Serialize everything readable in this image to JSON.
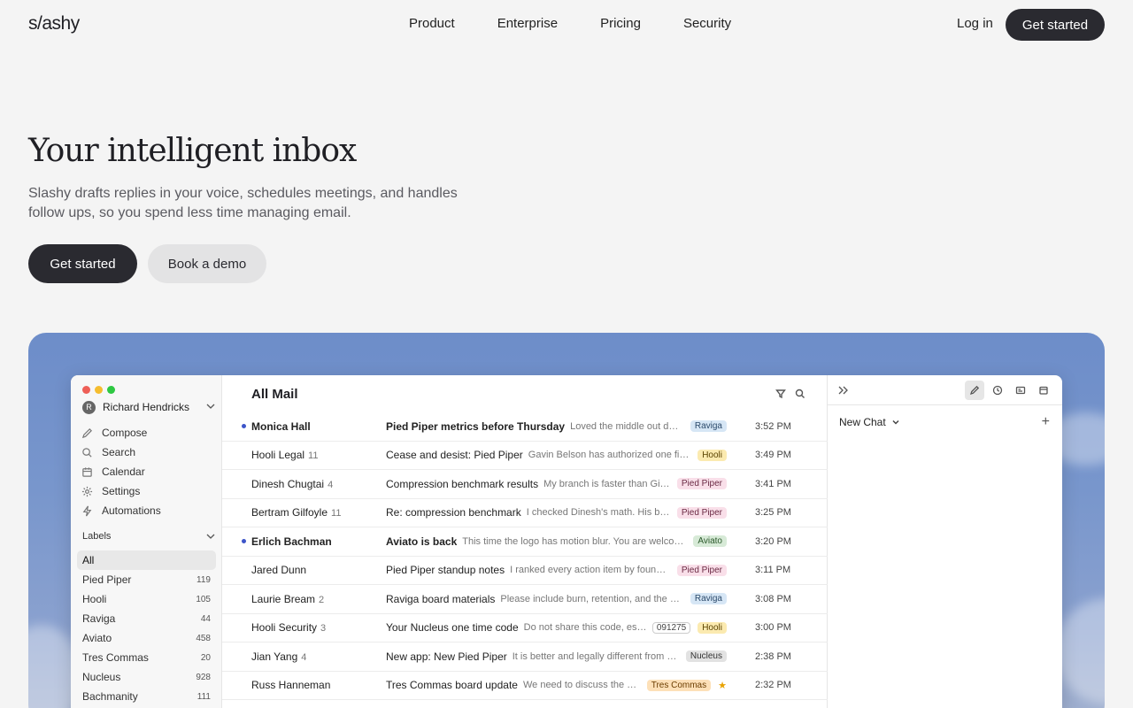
{
  "nav": {
    "logo": "s/ashy",
    "links": [
      "Product",
      "Enterprise",
      "Pricing",
      "Security"
    ],
    "login": "Log in",
    "cta": "Get started"
  },
  "hero": {
    "title": "Your intelligent inbox",
    "subtitle": "Slashy drafts replies in your voice, schedules meetings, and handles follow ups, so you spend less time managing email.",
    "primary_button": "Get started",
    "secondary_button": "Book a demo"
  },
  "app": {
    "account_initial": "R",
    "account_name": "Richard Hendricks",
    "menu": [
      {
        "label": "Compose",
        "icon": "pencil-icon"
      },
      {
        "label": "Search",
        "icon": "search-icon"
      },
      {
        "label": "Calendar",
        "icon": "calendar-icon"
      },
      {
        "label": "Settings",
        "icon": "gear-icon"
      },
      {
        "label": "Automations",
        "icon": "bolt-icon"
      }
    ],
    "labels_heading": "Labels",
    "labels": [
      {
        "name": "All",
        "count": "",
        "active": true
      },
      {
        "name": "Pied Piper",
        "count": "119"
      },
      {
        "name": "Hooli",
        "count": "105"
      },
      {
        "name": "Raviga",
        "count": "44"
      },
      {
        "name": "Aviato",
        "count": "458"
      },
      {
        "name": "Tres Commas",
        "count": "20"
      },
      {
        "name": "Nucleus",
        "count": "928"
      },
      {
        "name": "Bachmanity",
        "count": "111"
      }
    ],
    "list_title": "All Mail",
    "emails": [
      {
        "sender": "Monica Hall",
        "count": "",
        "unread": true,
        "subject": "Pied Piper metrics before Thursday",
        "preview": "Loved the middle out demo...",
        "tag": "Raviga",
        "time": "3:52 PM"
      },
      {
        "sender": "Hooli Legal",
        "count": "11",
        "unread": false,
        "subject": "Cease and desist: Pied Piper",
        "preview": "Gavin Belson has authorized one final,...",
        "tag": "Hooli",
        "time": "3:49 PM"
      },
      {
        "sender": "Dinesh Chugtai",
        "count": "4",
        "unread": false,
        "subject": "Compression benchmark results",
        "preview": "My branch is faster than Gilf...",
        "tag": "Pied Piper",
        "time": "3:41 PM"
      },
      {
        "sender": "Bertram Gilfoyle",
        "count": "11",
        "unread": false,
        "subject": "Re: compression benchmark",
        "preview": "I checked Dinesh's math. His ben...",
        "tag": "Pied Piper",
        "time": "3:25 PM"
      },
      {
        "sender": "Erlich Bachman",
        "count": "",
        "unread": true,
        "subject": "Aviato is back",
        "preview": "This time the logo has motion blur. You are welcome.",
        "tag": "Aviato",
        "time": "3:20 PM"
      },
      {
        "sender": "Jared Dunn",
        "count": "",
        "unread": false,
        "subject": "Pied Piper standup notes",
        "preview": "I ranked every action item by founde...",
        "tag": "Pied Piper",
        "time": "3:11 PM"
      },
      {
        "sender": "Laurie Bream",
        "count": "2",
        "unread": false,
        "subject": "Raviga board materials",
        "preview": "Please include burn, retention, and the up...",
        "tag": "Raviga",
        "time": "3:08 PM"
      },
      {
        "sender": "Hooli Security",
        "count": "3",
        "unread": false,
        "subject": "Your Nucleus one time code",
        "preview": "Do not share this code, esp...",
        "code": "091275",
        "tag": "Hooli",
        "time": "3:00 PM"
      },
      {
        "sender": "Jian Yang",
        "count": "4",
        "unread": false,
        "subject": "New app: New Pied Piper",
        "preview": "It is better and legally different from y...",
        "tag": "Nucleus",
        "time": "2:38 PM"
      },
      {
        "sender": "Russ Hanneman",
        "count": "",
        "unread": false,
        "subject": "Tres Commas board update",
        "preview": "We need to discuss the doors ...",
        "tag": "Tres Commas",
        "starred": true,
        "time": "2:32 PM"
      }
    ],
    "tag_colors": {
      "Raviga": {
        "bg": "#d6e6f5",
        "fg": "#2c4a6b"
      },
      "Hooli": {
        "bg": "#fbeab0",
        "fg": "#5a4300"
      },
      "Pied Piper": {
        "bg": "#f9dfe9",
        "fg": "#6b2a44"
      },
      "Aviato": {
        "bg": "#d7ead7",
        "fg": "#2c5a2c"
      },
      "Nucleus": {
        "bg": "#e2e2e2",
        "fg": "#333333"
      },
      "Tres Commas": {
        "bg": "#fde0b8",
        "fg": "#6b3d00"
      }
    },
    "panel": {
      "new_chat": "New Chat"
    }
  },
  "colors": {
    "accent_dark": "#2a2a30",
    "unread_dot": "#3d55c9"
  }
}
